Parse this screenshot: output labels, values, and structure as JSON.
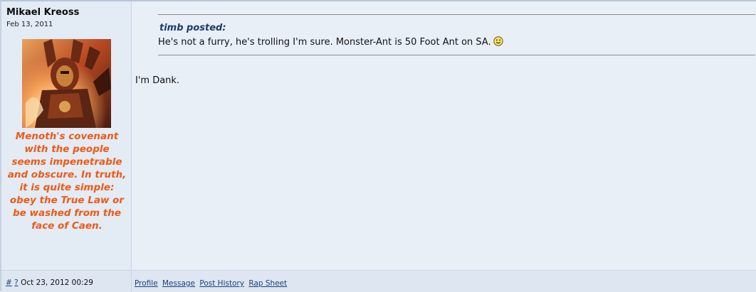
{
  "user": {
    "name": "Mikael Kreoss",
    "regdate": "Feb 13, 2011",
    "title": "Menoth's covenant with the people seems impenetrable and obscure. In truth, it is quite simple: obey the True Law or be washed from the face of Caen.",
    "title_color": "#f05a14"
  },
  "quote": {
    "author": "timb posted:",
    "text": "He's not a furry, he's trolling I'm sure. Monster-Ant is 50 Foot Ant on SA.",
    "smiley_icon": "smiley-icon"
  },
  "post": {
    "text": "I'm Dank."
  },
  "footer": {
    "hash": "#",
    "question": "?",
    "timestamp": "Oct 23, 2012 00:29",
    "links": [
      "Profile",
      "Message",
      "Post History",
      "Rap Sheet"
    ]
  },
  "colors": {
    "link": "#1f3f7a",
    "quote_author": "#1e3b6a",
    "background": "#e8eef6"
  }
}
